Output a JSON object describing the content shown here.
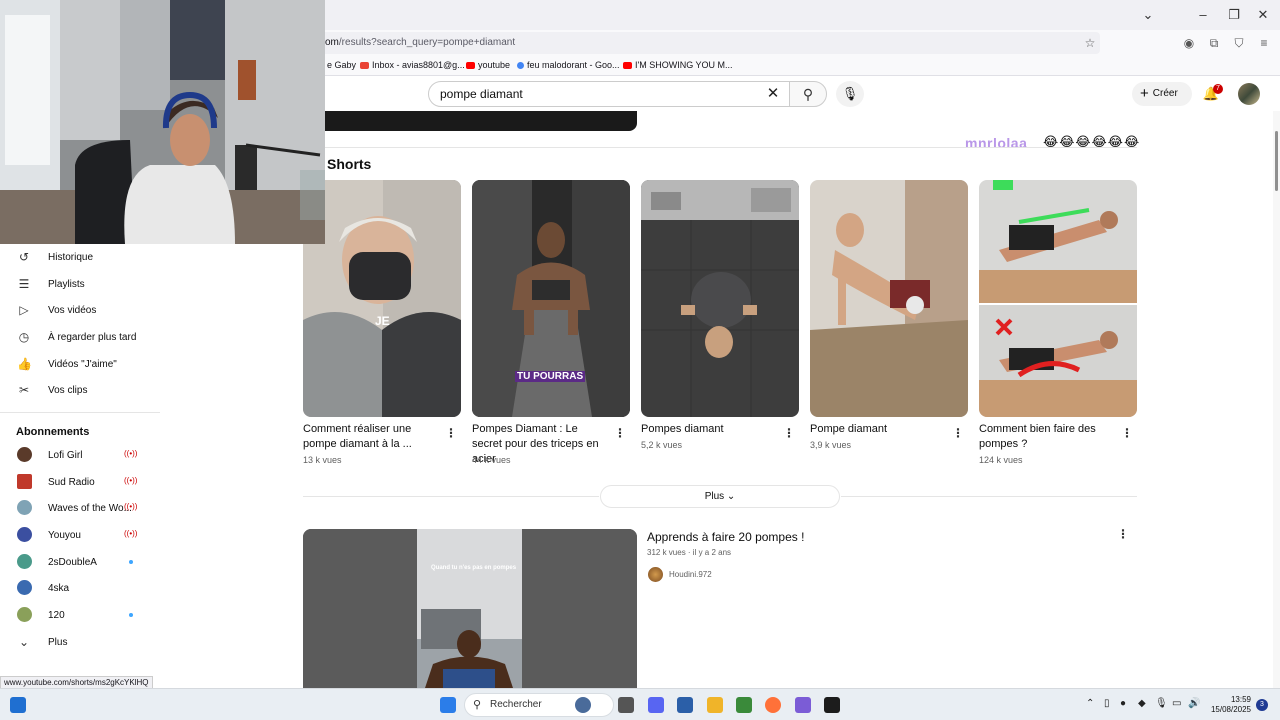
{
  "browser": {
    "url_host": "om",
    "url_path": "/results?search_query=pompe+diamant",
    "status_url": "www.youtube.com/shorts/ms2gKcYKlHQ"
  },
  "bookmarks": [
    {
      "label": "e Gaby",
      "color": "#ffffff"
    },
    {
      "label": "Inbox - avias8801@g...",
      "color": "#ea4335"
    },
    {
      "label": "youtube",
      "color": "#ff0000"
    },
    {
      "label": "feu malodorant - Goo...",
      "color": "#4285f4"
    },
    {
      "label": "I'M SHOWING YOU M...",
      "color": "#ff0000"
    }
  ],
  "header": {
    "search_value": "pompe diamant",
    "create_label": "Créer",
    "notification_count": "7"
  },
  "comment_overlay": {
    "username": "mnrlolaa",
    "emojis": "😂😂😂😂😂😂"
  },
  "shorts": {
    "title": "Shorts",
    "items": [
      {
        "title": "Comment réaliser une pompe diamant à la ...",
        "views": "13 k vues",
        "overlay": "JE"
      },
      {
        "title": "Pompes Diamant : Le secret pour des triceps en acier",
        "views": "44 k vues",
        "overlay": "TU POURRAS"
      },
      {
        "title": "Pompes diamant",
        "views": "5,2 k vues",
        "overlay": ""
      },
      {
        "title": "Pompe diamant",
        "views": "3,9 k vues",
        "overlay": ""
      },
      {
        "title": "Comment bien faire des pompes ?",
        "views": "124 k vues",
        "overlay": ""
      }
    ],
    "more_label": "Plus"
  },
  "video": {
    "title": "Apprends à faire 20 pompes !",
    "meta": "312 k vues · il y a 2 ans",
    "channel": "Houdini.972",
    "thumb_caption": "Quand tu n'es pas en pompes"
  },
  "sidebar": {
    "items": [
      {
        "label": "Historique",
        "icon": "history-icon"
      },
      {
        "label": "Playlists",
        "icon": "playlist-icon"
      },
      {
        "label": "Vos vidéos",
        "icon": "video-icon"
      },
      {
        "label": "À regarder plus tard",
        "icon": "clock-icon"
      },
      {
        "label": "Vidéos \"J'aime\"",
        "icon": "thumbs-up-icon"
      },
      {
        "label": "Vos clips",
        "icon": "scissors-icon"
      }
    ],
    "subscriptions_heading": "Abonnements",
    "subscriptions": [
      {
        "label": "Lofi Girl",
        "indicator": "live",
        "color": "#5a3a2a"
      },
      {
        "label": "Sud Radio",
        "indicator": "live",
        "color": "#c0392b"
      },
      {
        "label": "Waves of the Wo...",
        "indicator": "live",
        "color": "#7fa3b5"
      },
      {
        "label": "Youyou",
        "indicator": "live",
        "color": "#3b4fa0"
      },
      {
        "label": "2sDoubleA",
        "indicator": "dot",
        "color": "#4a9a8a"
      },
      {
        "label": "4ska",
        "indicator": "none",
        "color": "#3a6ab0"
      },
      {
        "label": "120",
        "indicator": "dot",
        "color": "#8aa05a"
      }
    ],
    "more_label": "Plus"
  },
  "taskbar": {
    "search_label": "Rechercher",
    "time": "13:59",
    "date": "15/08/2025",
    "notification_count": "3"
  }
}
